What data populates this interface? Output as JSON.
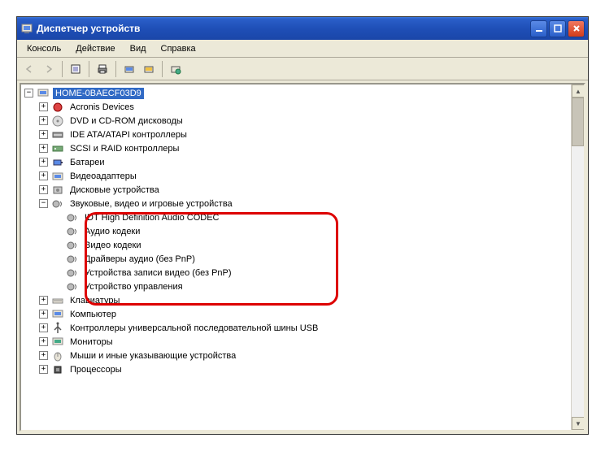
{
  "window": {
    "title": "Диспетчер устройств"
  },
  "menu": {
    "console": "Консоль",
    "action": "Действие",
    "view": "Вид",
    "help": "Справка"
  },
  "tree": {
    "root": "HOME-0BAECF03D9",
    "cat": {
      "acronis": "Acronis Devices",
      "dvd": "DVD и CD-ROM дисководы",
      "ide": "IDE ATA/ATAPI контроллеры",
      "scsi": "SCSI и RAID контроллеры",
      "battery": "Батареи",
      "video": "Видеоадаптеры",
      "disk": "Дисковые устройства",
      "sound": "Звуковые, видео и игровые устройства",
      "keyboard": "Клавиатуры",
      "computer": "Компьютер",
      "usb": "Контроллеры универсальной последовательной шины USB",
      "monitor": "Мониторы",
      "mouse": "Мыши и иные указывающие устройства",
      "cpu": "Процессоры"
    },
    "sound_children": {
      "idt": "IDT High Definition Audio CODEC",
      "acodec": "Аудио кодеки",
      "vcodec": "Видео кодеки",
      "adriver": "Драйверы аудио (без PnP)",
      "vrec": "Устройства записи видео (без PnP)",
      "ctrl": "Устройство управления"
    }
  }
}
